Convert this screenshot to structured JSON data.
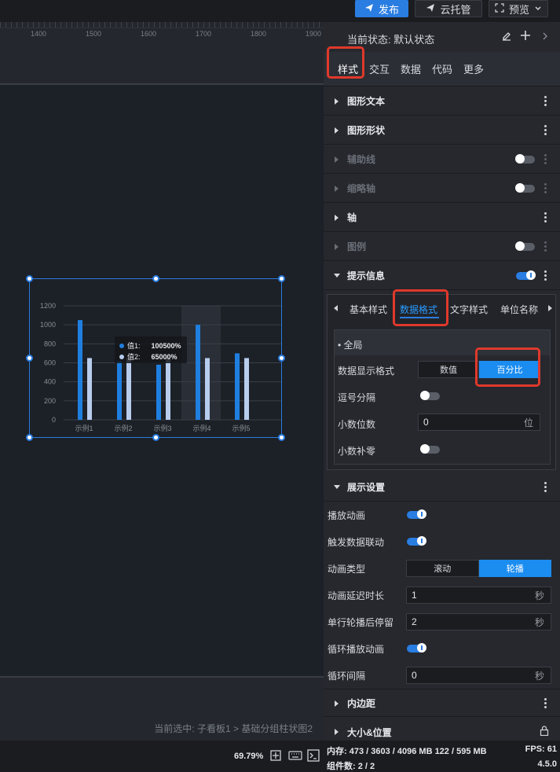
{
  "topbar": {
    "publish_label": "发布",
    "cloud_label": "云托管",
    "preview_label": "预览"
  },
  "ruler": {
    "ticks": [
      "1400",
      "1500",
      "1600",
      "1700",
      "1800",
      "1900"
    ]
  },
  "chart_data": {
    "type": "bar",
    "categories": [
      "示例1",
      "示例2",
      "示例3",
      "示例4",
      "示例5"
    ],
    "series": [
      {
        "name": "值1",
        "values": [
          1050,
          620,
          580,
          1000,
          700
        ],
        "color": "#1f7fe0"
      },
      {
        "name": "值2",
        "values": [
          650,
          650,
          650,
          650,
          650
        ],
        "color": "#b8cdee"
      }
    ],
    "ylim": [
      0,
      1200
    ],
    "yticks": [
      "0",
      "200",
      "400",
      "600",
      "800",
      "1000",
      "1200"
    ],
    "highlight_category": "示例4",
    "tooltip": [
      {
        "label": "值1:",
        "value": "100500%"
      },
      {
        "label": "值2:",
        "value": "65000%"
      }
    ]
  },
  "canvas": {
    "selection_text": "当前选中: 子看板1 > 基础分组柱状图2"
  },
  "statusbar": {
    "zoom": "69.79%",
    "memory": "内存: 473 / 3603 / 4096 MB  122 / 595 MB",
    "fps": "FPS: 61",
    "components": "组件数: 2 / 2",
    "version": "4.5.0"
  },
  "panel": {
    "state_label": "当前状态: 默认状态",
    "tabs": [
      "样式",
      "交互",
      "数据",
      "代码",
      "更多"
    ],
    "sections_top": [
      {
        "label": "图形文本",
        "dim": false,
        "toggle": null
      },
      {
        "label": "图形形状",
        "dim": false,
        "toggle": null
      },
      {
        "label": "辅助线",
        "dim": true,
        "toggle": "off"
      },
      {
        "label": "缩略轴",
        "dim": true,
        "toggle": "off"
      },
      {
        "label": "轴",
        "dim": false,
        "toggle": null
      },
      {
        "label": "图例",
        "dim": true,
        "toggle": "off"
      }
    ],
    "tooltip_section": {
      "label": "提示信息",
      "subtabs": [
        "基本样式",
        "数据格式",
        "文字样式",
        "单位名称"
      ],
      "global_label": "全局",
      "format_label": "数据显示格式",
      "format_options": [
        "数值",
        "百分比"
      ],
      "comma_label": "逗号分隔",
      "decimals_label": "小数位数",
      "decimals_value": "0",
      "decimals_unit": "位",
      "pad_label": "小数补零"
    },
    "display_section": {
      "label": "展示设置",
      "play_anim_label": "播放动画",
      "trigger_label": "触发数据联动",
      "anim_type_label": "动画类型",
      "anim_type_options": [
        "滚动",
        "轮播"
      ],
      "delay_label": "动画延迟时长",
      "delay_value": "1",
      "delay_unit": "秒",
      "stay_label": "单行轮播后停留",
      "stay_value": "2",
      "stay_unit": "秒",
      "loop_label": "循环播放动画",
      "interval_label": "循环间隔",
      "interval_value": "0",
      "interval_unit": "秒"
    },
    "padding_label": "内边距",
    "size_label": "大小&位置"
  }
}
